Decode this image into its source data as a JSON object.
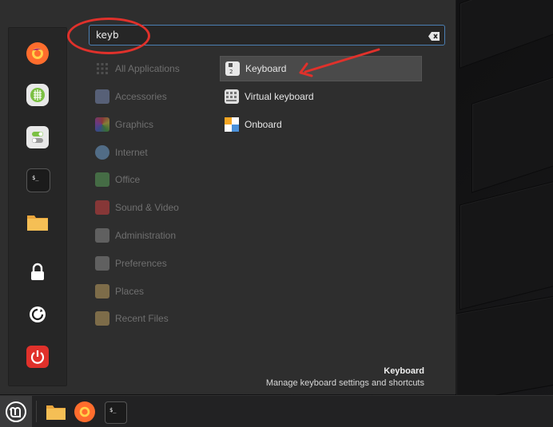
{
  "search": {
    "value": "keyb",
    "placeholder": ""
  },
  "favorites": [
    {
      "name": "firefox-icon"
    },
    {
      "name": "software-manager-icon"
    },
    {
      "name": "system-settings-icon"
    },
    {
      "name": "terminal-icon"
    },
    {
      "name": "files-icon"
    },
    {
      "name": "lock-screen-icon"
    },
    {
      "name": "logout-icon"
    },
    {
      "name": "power-icon"
    }
  ],
  "categories": [
    {
      "label": "All Applications",
      "color": "#6b6b6b"
    },
    {
      "label": "Accessories",
      "color": "#7a8bb5"
    },
    {
      "label": "Graphics",
      "color": "#d05a8a"
    },
    {
      "label": "Internet",
      "color": "#6fa0d0"
    },
    {
      "label": "Office",
      "color": "#5aa05a"
    },
    {
      "label": "Sound & Video",
      "color": "#d04040"
    },
    {
      "label": "Administration",
      "color": "#8a8a8a"
    },
    {
      "label": "Preferences",
      "color": "#8a8a8a"
    },
    {
      "label": "Places",
      "color": "#c0a060"
    },
    {
      "label": "Recent Files",
      "color": "#c0a060"
    }
  ],
  "results": [
    {
      "label": "Keyboard",
      "selected": true
    },
    {
      "label": "Virtual keyboard",
      "selected": false
    },
    {
      "label": "Onboard",
      "selected": false
    }
  ],
  "description": {
    "title": "Keyboard",
    "text": "Manage keyboard settings and shortcuts"
  },
  "annotation_color": "#e0312b"
}
